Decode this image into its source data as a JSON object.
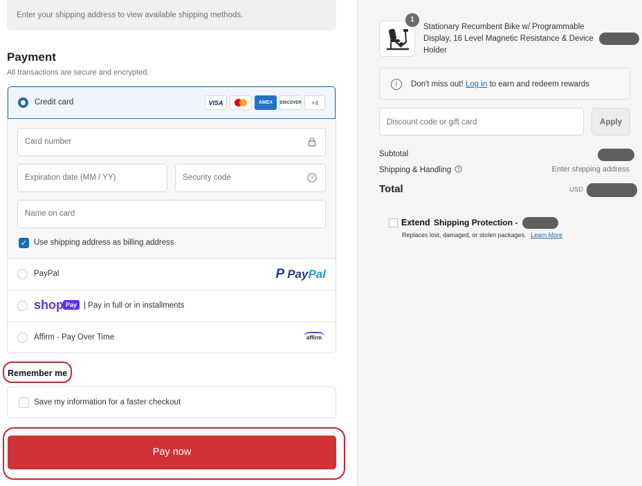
{
  "shipping_notice": "Enter your shipping address to view available shipping methods.",
  "payment": {
    "title": "Payment",
    "subtitle": "All transactions are secure and encrypted.",
    "credit_card": {
      "label": "Credit card",
      "selected": true,
      "brands": [
        "VISA",
        "mastercard",
        "AMEX",
        "DISCOVER",
        "+4"
      ],
      "card_number_placeholder": "Card number",
      "expiration_placeholder": "Expiration date (MM / YY)",
      "security_code_placeholder": "Security code",
      "name_placeholder": "Name on card",
      "billing_same_label": "Use shipping address as billing address",
      "billing_same_checked": true
    },
    "paypal": {
      "label": "PayPal",
      "logo_pay": "Pay",
      "logo_pal": "Pal"
    },
    "shop_pay": {
      "shop_word": "shop",
      "badge": "Pay",
      "text": "| Pay in full or in installments"
    },
    "affirm": {
      "label": "Affirm - Pay Over Time",
      "logo": "affirm"
    }
  },
  "remember_me": {
    "title": "Remember me",
    "save_label": "Save my information for a faster checkout",
    "checked": false
  },
  "pay_now_label": "Pay now",
  "order": {
    "product": {
      "quantity": "1",
      "name": "Stationary Recumbent Bike w/ Programmable Display, 16 Level Magnetic Resistance & Device Holder"
    },
    "rewards": {
      "prefix": "Don't miss out!",
      "link": "Log in",
      "suffix": "to earn and redeem rewards"
    },
    "discount_placeholder": "Discount code or gift card",
    "apply_label": "Apply",
    "subtotal_label": "Subtotal",
    "shipping_label": "Shipping & Handling",
    "shipping_value": "Enter shipping address",
    "total_label": "Total",
    "currency": "USD",
    "extend": {
      "brand": "Extend",
      "title": "Shipping Protection -",
      "subtitle": "Replaces lost, damaged, or stolen packages.",
      "link": "Learn More"
    }
  },
  "colors": {
    "accent": "#1b6cb0",
    "pay_button": "#d13237",
    "highlight_ring": "#d0202d",
    "shop_purple": "#5a31f4"
  }
}
